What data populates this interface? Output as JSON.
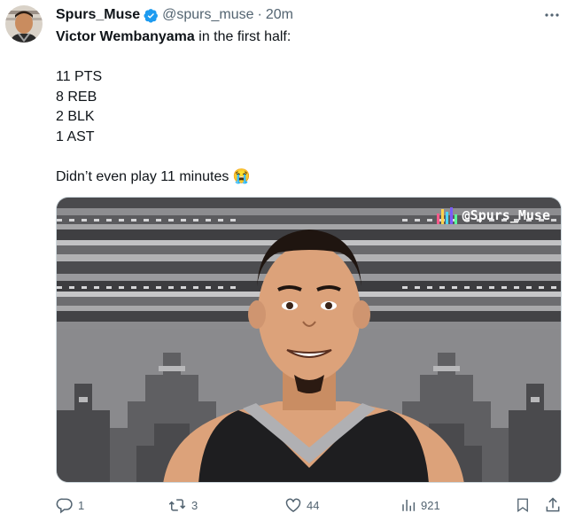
{
  "tweet": {
    "display_name": "Spurs_Muse",
    "handle": "@spurs_muse",
    "separator": "·",
    "time": "20m",
    "text": {
      "line1_bold": "Victor Wembanyama",
      "line1_rest": " in the first half:",
      "stats": [
        "11 PTS",
        "8 REB",
        "2 BLK",
        "1 AST"
      ],
      "closing": "Didn’t even play 11 minutes",
      "closing_emoji": "😭"
    },
    "media": {
      "watermark": "@Spurs_Muse"
    },
    "actions": {
      "replies": "1",
      "retweets": "3",
      "likes": "44",
      "views": "921"
    }
  },
  "colors": {
    "verified": "#1d9bf0",
    "secondary_text": "#536471",
    "primary_text": "#0f1419"
  },
  "icons": [
    "avatar",
    "verified-badge-icon",
    "more-icon",
    "reply-icon",
    "retweet-icon",
    "like-icon",
    "views-icon",
    "bookmark-icon",
    "share-icon"
  ]
}
